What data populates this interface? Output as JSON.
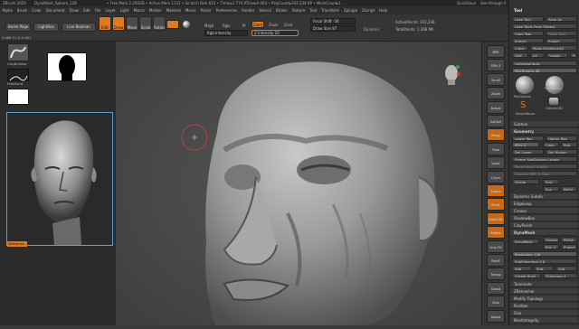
{
  "titlebar": {
    "app": "ZBrush 2020",
    "doc": "DynaMesh_Sphere_128",
    "mem": "• Free Mem 2.256GB • Active Mem 1131 • Scratch Disk 615 • Timer▸1.774 ATime▸0.064 • PolyCount▸342.234 KP • MeshCount▸1",
    "quicksave": "QuickSave",
    "seethrough": "See-through 0",
    "menus_label": "Menus",
    "script": "DefaultZScript"
  },
  "menubar": [
    "Alpha",
    "Brush",
    "Color",
    "Document",
    "Draw",
    "Edit",
    "File",
    "Layer",
    "Light",
    "Macro",
    "Marker",
    "Material",
    "Movie",
    "Picker",
    "Preferences",
    "Render",
    "Stencil",
    "Stroke",
    "Texture",
    "Tool",
    "Transform",
    "Zplugin",
    "Zscript",
    "Help"
  ],
  "shelf": {
    "home": "Home Page",
    "lightbox": "LightBox",
    "live_boolean": "Live Boolean",
    "coords": "X:488 Y:1 Z:-0.001",
    "edit": "Edit",
    "draw": "Draw",
    "move": "Move",
    "scale": "Scale",
    "rotate": "Rotate",
    "mrgb": "Mrgb",
    "rgb": "Rgb",
    "m": "M",
    "zadd": "Zadd",
    "zsub": "Zsub",
    "zcut": "Zcut",
    "rgb_intensity": "Rgb Intensity",
    "z_intensity": "Z Intensity 20",
    "focal_shift": "Focal Shift -56",
    "draw_size": "Draw Size 87",
    "dynamic": "Dynamic",
    "active_points": "ActivePoints: 342,236",
    "total_points": "TotalPoints: 1.368 Mil"
  },
  "leftpanel": {
    "brush_label": "ClayBuildup",
    "stroke_label": "FreeHand",
    "alpha_label": "Alpha Off",
    "texture_label": "Texture Off",
    "material_label": "MatCap Gray",
    "reference_label": "Reference"
  },
  "tray": {
    "buttons": [
      "BPR",
      "SPix 3",
      "Scroll",
      "Zoom",
      "Actual",
      "AAHalf",
      "Persp",
      "Floor",
      "Local",
      "LSym",
      "Frame",
      "Move",
      "Zoom3D",
      "Rotate",
      "Line Fill",
      "PolyF",
      "Transp",
      "Ghost",
      "Solo",
      "Xpose"
    ],
    "orange": [
      "Persp",
      "Frame",
      "Move",
      "Zoom3D",
      "Rotate"
    ]
  },
  "rightpanel": {
    "tool_header": "Tool",
    "load_tool": "Load Tool",
    "save_as": "Save As",
    "load_from_project": "Load Tools From Project",
    "copy_tool": "Copy Tool",
    "paste_tool": "Paste Tool",
    "import": "Import",
    "export": "Export",
    "clone": "Clone",
    "make_polymesh": "Make PolyMesh3D",
    "goz": "GoZ",
    "all": "All",
    "visible": "Visible",
    "r": "R",
    "lightbox_tools": "Lightbox▸Tools",
    "polysphere": "PolySphere  48",
    "thumbs": [
      "PolySphere",
      "PolySphere",
      "Cylinder3D",
      "SimpleBrush"
    ],
    "subtool": "Subtool",
    "geometry": "Geometry",
    "lower_res": "Lower Res",
    "higher_res": "Higher Res",
    "sdiv": "SDiv 4",
    "cage": "Cage",
    "rstr": "Rstr",
    "del_lower": "Del Lower",
    "del_higher": "Del Higher",
    "freeze": "Freeze SubDivision Levels",
    "reconstruct": "Reconstruct Subdiv",
    "convert_bpr": "Convert BPR To Geo",
    "divide": "Divide",
    "smt": "Smt",
    "suv": "Suv",
    "rsm": "ReUV",
    "dynamic_subdiv": "Dynamic Subdiv",
    "edgeloop": "EdgeLoop",
    "crease": "Crease",
    "shadowbox": "ShadowBox",
    "claypolish": "ClayPolish",
    "dynamesh": "DynaMesh",
    "dynamesh_btn": "DynaMesh",
    "groups": "Groups",
    "polish": "Polish",
    "blur": "Blur 2",
    "project": "Project",
    "resolution": "Resolution 128",
    "subprojection": "SubProjection 0.6",
    "add": "Add",
    "sub": "Sub",
    "and": "And",
    "create_shell": "Create Shell",
    "thickness": "Thickness 4",
    "tessimate": "Tessimate",
    "zremesher": "ZRemesher",
    "modify_topology": "Modify Topology",
    "position": "Position",
    "size": "Size",
    "meshintegrity": "MeshIntegrity"
  },
  "colors": {
    "accent": "#e07a1f",
    "canvas_bg": "#4a4a4a",
    "panel_bg": "#323232"
  }
}
